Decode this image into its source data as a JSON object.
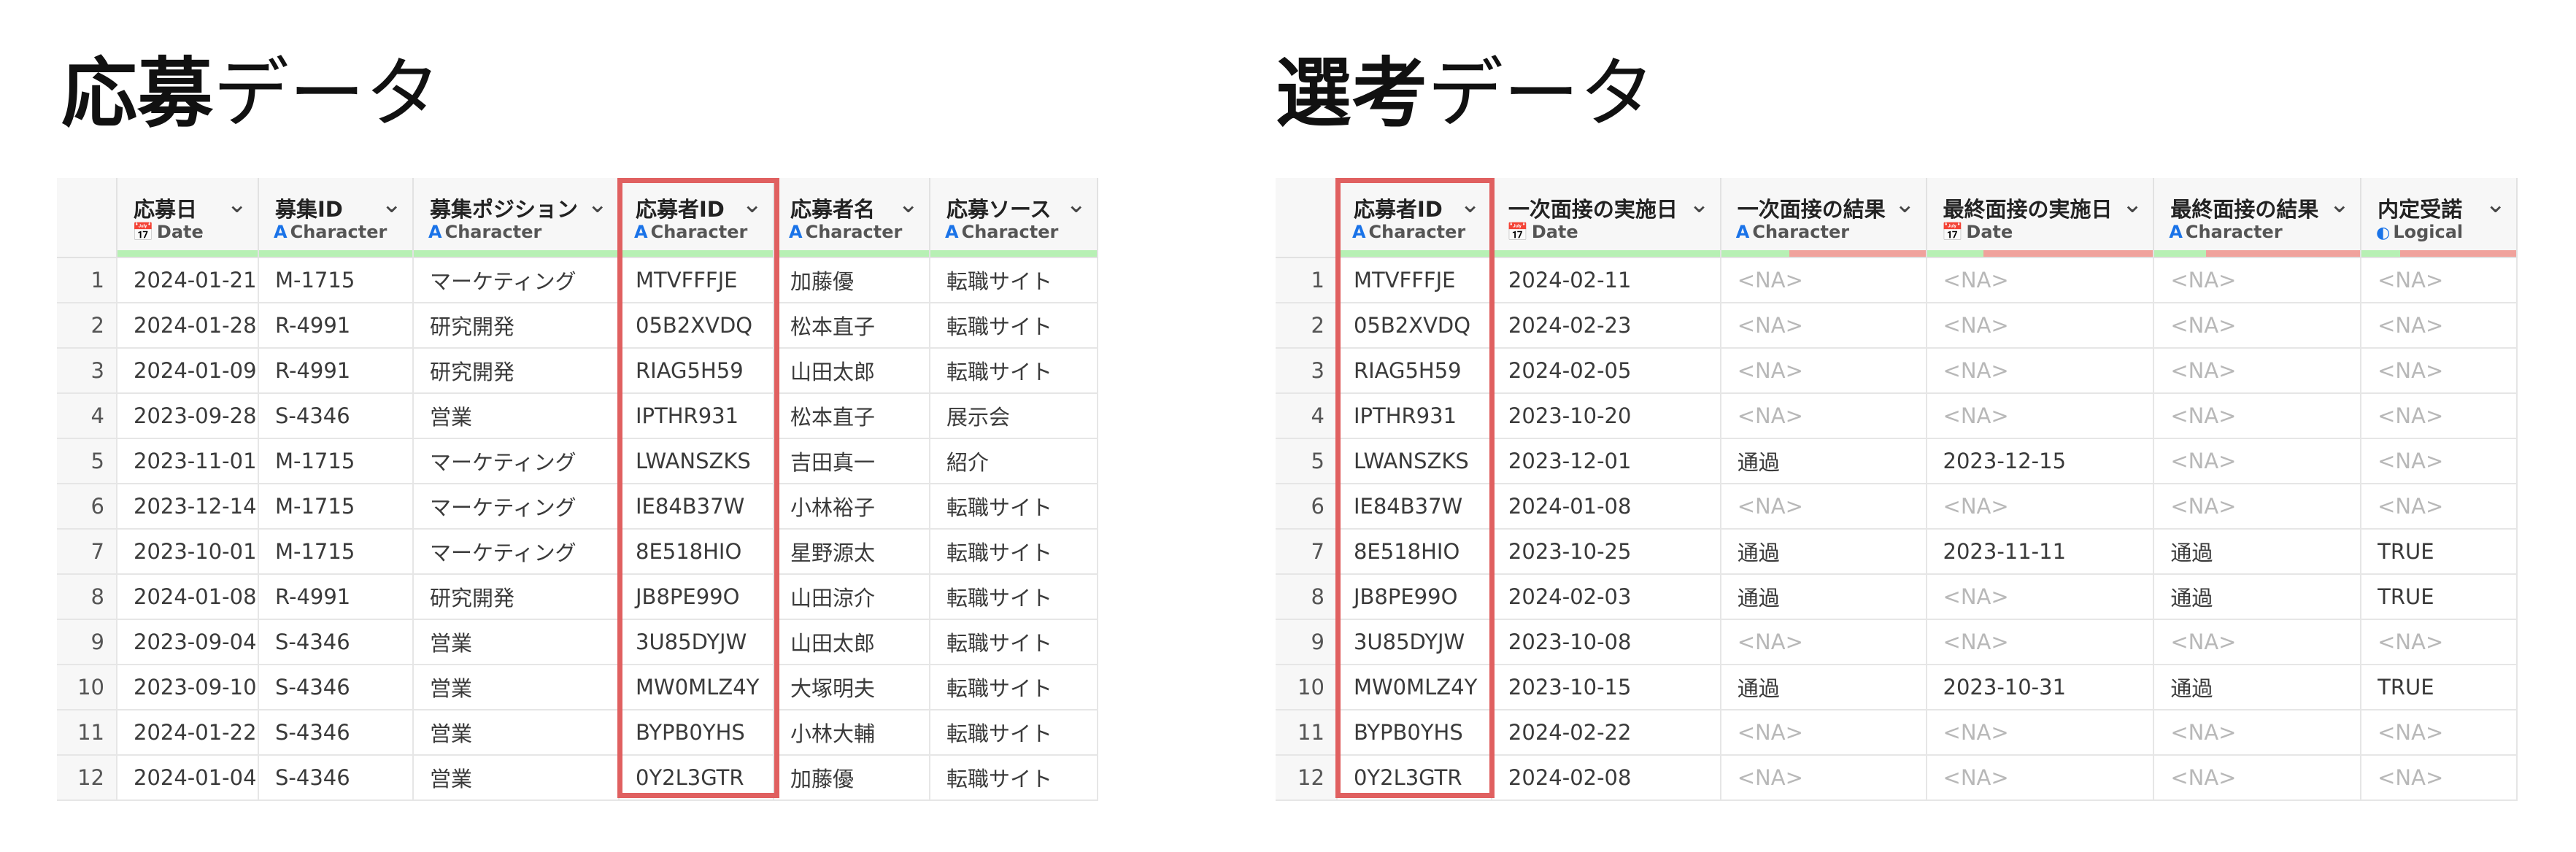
{
  "left": {
    "title_bold": "応募",
    "title_rest": "データ",
    "columns": [
      {
        "name": "応募日",
        "type": "Date",
        "icon": "calendar-icon"
      },
      {
        "name": "募集ID",
        "type": "Character",
        "icon": "character-type-icon"
      },
      {
        "name": "募集ポジション",
        "type": "Character",
        "icon": "character-type-icon"
      },
      {
        "name": "応募者ID",
        "type": "Character",
        "icon": "character-type-icon"
      },
      {
        "name": "応募者名",
        "type": "Character",
        "icon": "character-type-icon"
      },
      {
        "name": "応募ソース",
        "type": "Character",
        "icon": "character-type-icon"
      }
    ],
    "rows": [
      [
        "1",
        "2024-01-21",
        "M-1715",
        "マーケティング",
        "MTVFFFJE",
        "加藤優",
        "転職サイト"
      ],
      [
        "2",
        "2024-01-28",
        "R-4991",
        "研究開発",
        "05B2XVDQ",
        "松本直子",
        "転職サイト"
      ],
      [
        "3",
        "2024-01-09",
        "R-4991",
        "研究開発",
        "RIAG5H59",
        "山田太郎",
        "転職サイト"
      ],
      [
        "4",
        "2023-09-28",
        "S-4346",
        "営業",
        "IPTHR931",
        "松本直子",
        "展示会"
      ],
      [
        "5",
        "2023-11-01",
        "M-1715",
        "マーケティング",
        "LWANSZKS",
        "吉田真一",
        "紹介"
      ],
      [
        "6",
        "2023-12-14",
        "M-1715",
        "マーケティング",
        "IE84B37W",
        "小林裕子",
        "転職サイト"
      ],
      [
        "7",
        "2023-10-01",
        "M-1715",
        "マーケティング",
        "8E518HIO",
        "星野源太",
        "転職サイト"
      ],
      [
        "8",
        "2024-01-08",
        "R-4991",
        "研究開発",
        "JB8PE99O",
        "山田涼介",
        "転職サイト"
      ],
      [
        "9",
        "2023-09-04",
        "S-4346",
        "営業",
        "3U85DYJW",
        "山田太郎",
        "転職サイト"
      ],
      [
        "10",
        "2023-09-10",
        "S-4346",
        "営業",
        "MW0MLZ4Y",
        "大塚明夫",
        "転職サイト"
      ],
      [
        "11",
        "2024-01-22",
        "S-4346",
        "営業",
        "BYPB0YHS",
        "小林大輔",
        "転職サイト"
      ],
      [
        "12",
        "2024-01-04",
        "S-4346",
        "営業",
        "0Y2L3GTR",
        "加藤優",
        "転職サイト"
      ]
    ]
  },
  "right": {
    "title_bold": "選考",
    "title_rest": "データ",
    "columns": [
      {
        "name": "応募者ID",
        "type": "Character",
        "icon": "character-type-icon"
      },
      {
        "name": "一次面接の実施日",
        "type": "Date",
        "icon": "calendar-icon"
      },
      {
        "name": "一次面接の結果",
        "type": "Character",
        "icon": "character-type-icon"
      },
      {
        "name": "最終面接の実施日",
        "type": "Date",
        "icon": "calendar-icon"
      },
      {
        "name": "最終面接の結果",
        "type": "Character",
        "icon": "character-type-icon"
      },
      {
        "name": "内定受諾",
        "type": "Logical",
        "icon": "logical-toggle-icon"
      }
    ],
    "rows": [
      [
        "1",
        "MTVFFFJE",
        "2024-02-11",
        "<NA>",
        "<NA>",
        "<NA>",
        "<NA>"
      ],
      [
        "2",
        "05B2XVDQ",
        "2024-02-23",
        "<NA>",
        "<NA>",
        "<NA>",
        "<NA>"
      ],
      [
        "3",
        "RIAG5H59",
        "2024-02-05",
        "<NA>",
        "<NA>",
        "<NA>",
        "<NA>"
      ],
      [
        "4",
        "IPTHR931",
        "2023-10-20",
        "<NA>",
        "<NA>",
        "<NA>",
        "<NA>"
      ],
      [
        "5",
        "LWANSZKS",
        "2023-12-01",
        "通過",
        "2023-12-15",
        "<NA>",
        "<NA>"
      ],
      [
        "6",
        "IE84B37W",
        "2024-01-08",
        "<NA>",
        "<NA>",
        "<NA>",
        "<NA>"
      ],
      [
        "7",
        "8E518HIO",
        "2023-10-25",
        "通過",
        "2023-11-11",
        "通過",
        "TRUE"
      ],
      [
        "8",
        "JB8PE99O",
        "2024-02-03",
        "通過",
        "<NA>",
        "通過",
        "TRUE"
      ],
      [
        "9",
        "3U85DYJW",
        "2023-10-08",
        "<NA>",
        "<NA>",
        "<NA>",
        "<NA>"
      ],
      [
        "10",
        "MW0MLZ4Y",
        "2023-10-15",
        "通過",
        "2023-10-31",
        "通過",
        "TRUE"
      ],
      [
        "11",
        "BYPB0YHS",
        "2024-02-22",
        "<NA>",
        "<NA>",
        "<NA>",
        "<NA>"
      ],
      [
        "12",
        "0Y2L3GTR",
        "2024-02-08",
        "<NA>",
        "<NA>",
        "<NA>",
        "<NA>"
      ]
    ]
  },
  "colors": {
    "highlight": "#e06060",
    "valid_bar": "#b7f0b4",
    "missing_bar": "#f0a29c",
    "type_icon": "#1a73e8"
  },
  "chevron_icon": "chevron-down-icon"
}
